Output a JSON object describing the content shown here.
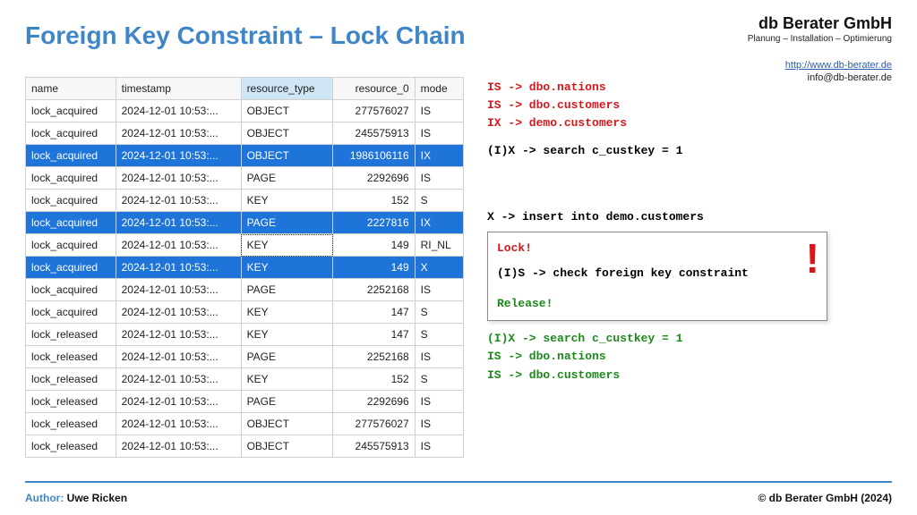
{
  "header": {
    "title": "Foreign Key Constraint – Lock Chain",
    "company": "db Berater GmbH",
    "tagline": "Planung – Installation – Optimierung",
    "url": "http://www.db-berater.de",
    "email": "info@db-berater.de"
  },
  "table": {
    "columns": [
      "name",
      "timestamp",
      "resource_type",
      "resource_0",
      "mode"
    ],
    "rows": [
      {
        "name": "lock_acquired",
        "timestamp": "2024-12-01 10:53:...",
        "resource_type": "OBJECT",
        "resource_0": "277576027",
        "mode": "IS",
        "hl": false
      },
      {
        "name": "lock_acquired",
        "timestamp": "2024-12-01 10:53:...",
        "resource_type": "OBJECT",
        "resource_0": "245575913",
        "mode": "IS",
        "hl": false
      },
      {
        "name": "lock_acquired",
        "timestamp": "2024-12-01 10:53:...",
        "resource_type": "OBJECT",
        "resource_0": "1986106116",
        "mode": "IX",
        "hl": true
      },
      {
        "name": "lock_acquired",
        "timestamp": "2024-12-01 10:53:...",
        "resource_type": "PAGE",
        "resource_0": "2292696",
        "mode": "IS",
        "hl": false
      },
      {
        "name": "lock_acquired",
        "timestamp": "2024-12-01 10:53:...",
        "resource_type": "KEY",
        "resource_0": "152",
        "mode": "S",
        "hl": false
      },
      {
        "name": "lock_acquired",
        "timestamp": "2024-12-01 10:53:...",
        "resource_type": "PAGE",
        "resource_0": "2227816",
        "mode": "IX",
        "hl": true
      },
      {
        "name": "lock_acquired",
        "timestamp": "2024-12-01 10:53:...",
        "resource_type": "KEY",
        "resource_0": "149",
        "mode": "RI_NL",
        "hl": false,
        "dotted": true
      },
      {
        "name": "lock_acquired",
        "timestamp": "2024-12-01 10:53:...",
        "resource_type": "KEY",
        "resource_0": "149",
        "mode": "X",
        "hl": true
      },
      {
        "name": "lock_acquired",
        "timestamp": "2024-12-01 10:53:...",
        "resource_type": "PAGE",
        "resource_0": "2252168",
        "mode": "IS",
        "hl": false
      },
      {
        "name": "lock_acquired",
        "timestamp": "2024-12-01 10:53:...",
        "resource_type": "KEY",
        "resource_0": "147",
        "mode": "S",
        "hl": false
      },
      {
        "name": "lock_released",
        "timestamp": "2024-12-01 10:53:...",
        "resource_type": "KEY",
        "resource_0": "147",
        "mode": "S",
        "hl": false
      },
      {
        "name": "lock_released",
        "timestamp": "2024-12-01 10:53:...",
        "resource_type": "PAGE",
        "resource_0": "2252168",
        "mode": "IS",
        "hl": false
      },
      {
        "name": "lock_released",
        "timestamp": "2024-12-01 10:53:...",
        "resource_type": "KEY",
        "resource_0": "152",
        "mode": "S",
        "hl": false
      },
      {
        "name": "lock_released",
        "timestamp": "2024-12-01 10:53:...",
        "resource_type": "PAGE",
        "resource_0": "2292696",
        "mode": "IS",
        "hl": false
      },
      {
        "name": "lock_released",
        "timestamp": "2024-12-01 10:53:...",
        "resource_type": "OBJECT",
        "resource_0": "277576027",
        "mode": "IS",
        "hl": false
      },
      {
        "name": "lock_released",
        "timestamp": "2024-12-01 10:53:...",
        "resource_type": "OBJECT",
        "resource_0": "245575913",
        "mode": "IS",
        "hl": false
      }
    ]
  },
  "annotations": {
    "line1": "IS -> dbo.nations",
    "line2": "IS -> dbo.customers",
    "line3": "IX -> demo.customers",
    "line4": "(I)X -> search c_custkey = 1",
    "line5": "X -> insert into demo.customers",
    "box_lock": "Lock!",
    "box_mid": "(I)S -> check foreign key constraint",
    "box_release": "Release!",
    "line6": "(I)X -> search c_custkey = 1",
    "line7": "IS -> dbo.nations",
    "line8": "IS -> dbo.customers"
  },
  "footer": {
    "author_label": "Author:",
    "author_name": "Uwe Ricken",
    "copyright": "© db Berater GmbH (2024)"
  }
}
